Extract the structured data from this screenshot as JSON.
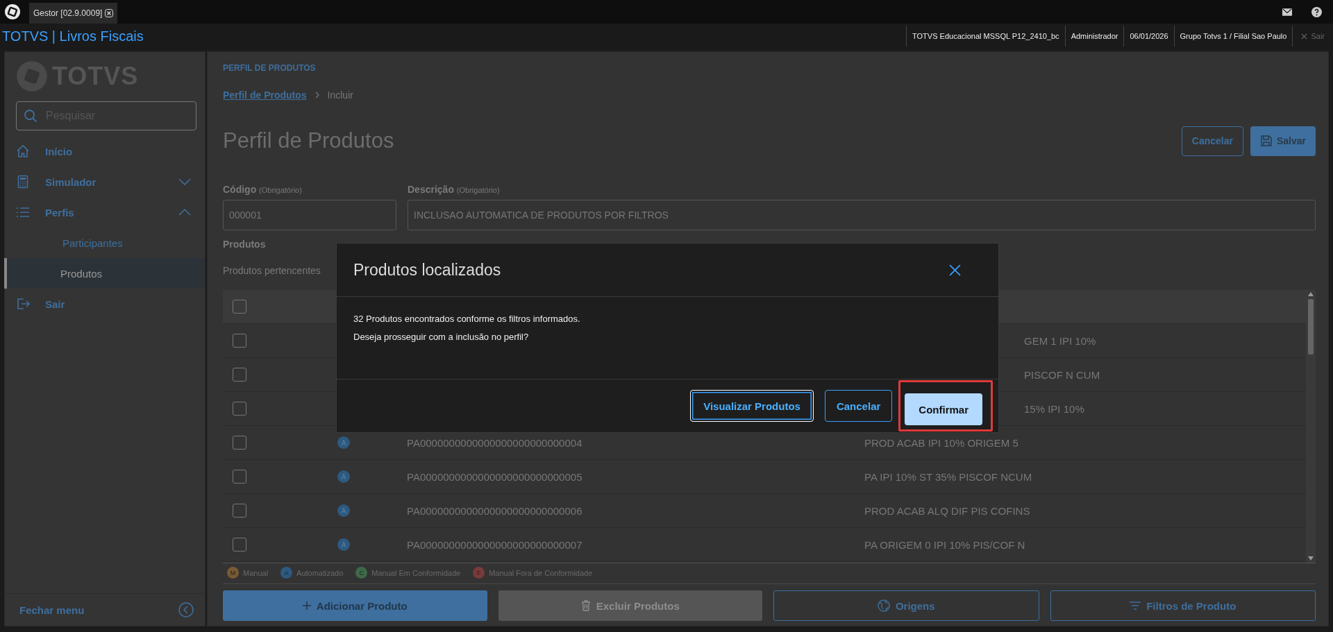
{
  "app_tabs": [
    {
      "label": "Gestor [02.9.0009]",
      "selected": true
    }
  ],
  "header": {
    "title": "TOTVS | Livros Fiscais",
    "info": [
      "TOTVS Educacional MSSQL P12_2410_bc",
      "Administrador",
      "06/01/2026",
      "Grupo Totvs 1 / Filial Sao Paulo"
    ],
    "exit": {
      "label": "Sair",
      "disabled": true
    }
  },
  "sidebar": {
    "logo": "TOTVS",
    "search": {
      "placeholder": "Pesquisar"
    },
    "items": [
      {
        "label": "Início"
      },
      {
        "label": "Simulador",
        "expanded": false
      },
      {
        "label": "Perfis",
        "expanded": true,
        "children": [
          {
            "label": "Participantes",
            "selected": false
          },
          {
            "label": "Produtos",
            "selected": true
          }
        ]
      },
      {
        "label": "Sair"
      }
    ],
    "collapse": "Fechar menu"
  },
  "page": {
    "section": "PERFIL DE PRODUTOS",
    "breadcrumb": [
      {
        "label": "Perfil de Produtos",
        "link": true
      },
      {
        "label": "Incluir",
        "link": false
      }
    ],
    "title": "Perfil de Produtos",
    "actions": [
      {
        "label": "Cancelar",
        "kind": "outline"
      },
      {
        "label": "Salvar",
        "kind": "primary"
      }
    ],
    "fields": [
      {
        "label": "Código",
        "hint": "(Obrigatório)",
        "value": "000001"
      },
      {
        "label": "Descrição",
        "hint": "(Obrigatório)",
        "value": "INCLUSAO AUTOMATICA DE PRODUTOS POR FILTROS"
      }
    ],
    "products_heading": "Produtos",
    "products_note": "Produtos pertencentes",
    "table": {
      "select_all": {
        "checked": false
      },
      "rows": [
        {
          "kind": "covered",
          "checked": false,
          "description": "GEM 1 IPI 10%"
        },
        {
          "kind": "covered",
          "checked": false,
          "description": "PISCOF N CUM"
        },
        {
          "kind": "covered",
          "checked": false,
          "description": "15% IPI 10%"
        },
        {
          "kind": "full",
          "checked": false,
          "origin": "A",
          "color": "#2d5a80",
          "code": "PA0000000000000000000000000004",
          "description": "PROD ACAB IPI 10% ORIGEM 5"
        },
        {
          "kind": "full",
          "checked": false,
          "origin": "A",
          "color": "#2d5a80",
          "code": "PA0000000000000000000000000005",
          "description": "PA IPI 10% ST 35% PISCOF NCUM"
        },
        {
          "kind": "full",
          "checked": false,
          "origin": "A",
          "color": "#2d5a80",
          "code": "PA0000000000000000000000000006",
          "description": "PROD ACAB ALQ DIF PIS COFINS"
        },
        {
          "kind": "full",
          "checked": false,
          "origin": "A",
          "color": "#2d5a80",
          "code": "PA0000000000000000000000000007",
          "description": "PA ORIGEM 0 IPI 10% PIS/COF N"
        }
      ]
    },
    "legend": [
      {
        "mark": "M",
        "label": "Manual",
        "color": "#7a5a32"
      },
      {
        "mark": "A",
        "label": "Automatizado",
        "color": "#2d5a80"
      },
      {
        "mark": "C",
        "label": "Manual Em Conformidade",
        "color": "#3d6a48"
      },
      {
        "mark": "F",
        "label": "Manual Fora de Conformidade",
        "color": "#7a3a3a"
      }
    ],
    "buttons": [
      {
        "label": "Adicionar Produto",
        "kind": "primary",
        "disabled": false
      },
      {
        "label": "Excluir Produtos",
        "kind": "primary",
        "disabled": true
      },
      {
        "label": "Origens",
        "kind": "outline",
        "disabled": false
      },
      {
        "label": "Filtros de Produto",
        "kind": "outline",
        "disabled": false
      }
    ]
  },
  "modal": {
    "title": "Produtos localizados",
    "lines": [
      "32 Produtos encontrados conforme os filtros informados.",
      "Deseja prosseguir com a inclusão no perfil?"
    ],
    "buttons": [
      {
        "label": "Visualizar Produtos",
        "kind": "outline",
        "focused": true,
        "highlighted": false
      },
      {
        "label": "Cancelar",
        "kind": "outline",
        "focused": false,
        "highlighted": false
      },
      {
        "label": "Confirmar",
        "kind": "primary",
        "focused": false,
        "highlighted": true
      }
    ]
  }
}
